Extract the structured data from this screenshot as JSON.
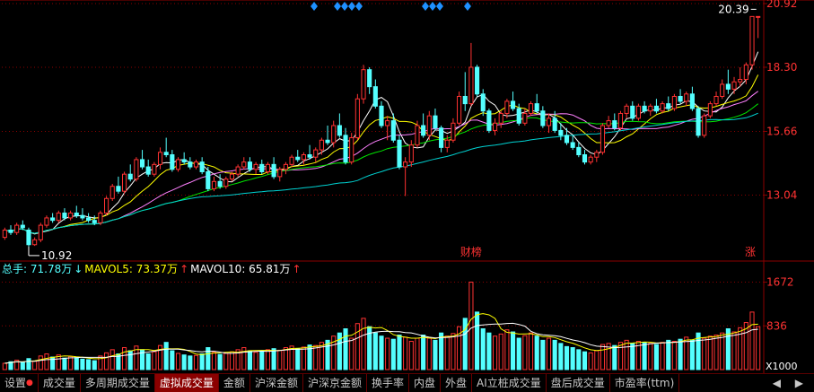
{
  "chart_data": [
    {
      "type": "candlestick",
      "price_axis_ticks": [
        "20.92",
        "18.30",
        "15.66",
        "13.04"
      ],
      "price_tick_values": [
        20.92,
        18.3,
        15.66,
        13.04
      ],
      "ylim": [
        10.4,
        20.92
      ],
      "last_price_label": "20.39",
      "last_price": 20.39,
      "low_label": "10.92",
      "low_price": 10.92,
      "low_bar_index": 4,
      "event_marker_label": "财榜",
      "event_marker_index": 78,
      "limit_up_label": "涨",
      "bars": [
        [
          11.3,
          11.7,
          11.2,
          11.6
        ],
        [
          11.6,
          11.8,
          11.4,
          11.5
        ],
        [
          11.5,
          11.9,
          11.4,
          11.8
        ],
        [
          11.8,
          12.0,
          11.6,
          11.7
        ],
        [
          11.6,
          11.7,
          10.92,
          11.0
        ],
        [
          11.0,
          11.3,
          10.95,
          11.2
        ],
        [
          11.2,
          11.9,
          11.1,
          11.8
        ],
        [
          11.8,
          12.2,
          11.7,
          12.1
        ],
        [
          12.1,
          12.3,
          11.9,
          12.0
        ],
        [
          12.0,
          12.4,
          11.9,
          12.3
        ],
        [
          12.3,
          12.5,
          12.0,
          12.1
        ],
        [
          12.1,
          12.4,
          12.0,
          12.3
        ],
        [
          12.3,
          12.6,
          12.1,
          12.2
        ],
        [
          12.2,
          12.5,
          12.0,
          12.1
        ],
        [
          12.1,
          12.3,
          11.9,
          12.0
        ],
        [
          12.0,
          12.2,
          11.8,
          11.9
        ],
        [
          11.9,
          12.4,
          11.8,
          12.3
        ],
        [
          12.3,
          13.0,
          12.2,
          12.9
        ],
        [
          12.9,
          13.5,
          12.8,
          13.4
        ],
        [
          13.4,
          13.8,
          13.1,
          13.2
        ],
        [
          13.2,
          14.0,
          13.1,
          13.9
        ],
        [
          13.9,
          14.3,
          13.6,
          13.7
        ],
        [
          13.7,
          14.6,
          13.6,
          14.5
        ],
        [
          14.5,
          14.9,
          14.1,
          14.2
        ],
        [
          14.2,
          14.5,
          13.8,
          13.9
        ],
        [
          13.9,
          14.4,
          13.8,
          14.3
        ],
        [
          14.3,
          15.0,
          14.1,
          14.8
        ],
        [
          14.8,
          15.4,
          14.6,
          14.7
        ],
        [
          14.7,
          14.9,
          14.0,
          14.1
        ],
        [
          14.1,
          14.6,
          14.0,
          14.5
        ],
        [
          14.5,
          14.8,
          14.3,
          14.4
        ],
        [
          14.4,
          14.6,
          14.1,
          14.2
        ],
        [
          14.2,
          14.5,
          14.1,
          14.4
        ],
        [
          14.4,
          14.6,
          13.9,
          14.0
        ],
        [
          14.0,
          14.2,
          13.2,
          13.3
        ],
        [
          13.3,
          13.8,
          13.2,
          13.6
        ],
        [
          13.6,
          13.9,
          13.3,
          13.4
        ],
        [
          13.4,
          13.8,
          13.3,
          13.7
        ],
        [
          13.7,
          14.0,
          13.6,
          13.9
        ],
        [
          13.9,
          14.3,
          13.8,
          14.2
        ],
        [
          14.2,
          14.6,
          14.1,
          14.4
        ],
        [
          14.4,
          14.6,
          14.0,
          14.1
        ],
        [
          14.1,
          14.4,
          13.9,
          14.3
        ],
        [
          14.3,
          14.5,
          13.9,
          14.0
        ],
        [
          14.0,
          14.4,
          13.9,
          14.3
        ],
        [
          14.3,
          14.6,
          13.7,
          13.8
        ],
        [
          13.8,
          14.2,
          13.6,
          14.1
        ],
        [
          14.1,
          14.4,
          13.9,
          14.3
        ],
        [
          14.3,
          14.7,
          14.2,
          14.6
        ],
        [
          14.6,
          14.9,
          14.4,
          14.5
        ],
        [
          14.5,
          14.8,
          14.3,
          14.7
        ],
        [
          14.7,
          15.1,
          14.5,
          14.6
        ],
        [
          14.6,
          15.0,
          14.4,
          14.9
        ],
        [
          14.9,
          15.4,
          14.7,
          15.3
        ],
        [
          15.3,
          15.9,
          15.1,
          15.2
        ],
        [
          15.2,
          16.1,
          15.0,
          15.9
        ],
        [
          15.9,
          16.4,
          15.4,
          15.5
        ],
        [
          15.5,
          15.8,
          14.3,
          14.4
        ],
        [
          14.4,
          15.6,
          14.3,
          15.4
        ],
        [
          15.4,
          17.2,
          15.3,
          17.0
        ],
        [
          17.0,
          18.4,
          16.8,
          18.2
        ],
        [
          18.2,
          18.3,
          17.2,
          17.5
        ],
        [
          17.5,
          17.8,
          16.6,
          16.7
        ],
        [
          16.7,
          16.9,
          15.8,
          15.9
        ],
        [
          15.9,
          16.3,
          15.3,
          16.1
        ],
        [
          16.1,
          16.4,
          15.2,
          15.3
        ],
        [
          15.3,
          15.5,
          14.1,
          14.2
        ],
        [
          14.2,
          14.6,
          13.0,
          14.4
        ],
        [
          14.4,
          15.3,
          14.2,
          15.1
        ],
        [
          15.1,
          16.1,
          15.0,
          15.9
        ],
        [
          15.9,
          16.4,
          15.4,
          15.5
        ],
        [
          15.5,
          16.5,
          15.3,
          16.3
        ],
        [
          16.3,
          16.6,
          15.7,
          15.8
        ],
        [
          15.8,
          15.9,
          14.8,
          15.0
        ],
        [
          15.0,
          15.5,
          14.8,
          15.3
        ],
        [
          15.3,
          16.2,
          15.2,
          16.0
        ],
        [
          16.0,
          17.3,
          15.9,
          17.1
        ],
        [
          17.1,
          18.1,
          16.5,
          16.8
        ],
        [
          16.8,
          19.3,
          16.7,
          18.3
        ],
        [
          18.3,
          18.4,
          17.1,
          17.2
        ],
        [
          17.2,
          17.4,
          16.3,
          16.5
        ],
        [
          16.5,
          16.6,
          15.6,
          15.7
        ],
        [
          15.7,
          16.2,
          15.5,
          16.0
        ],
        [
          16.0,
          16.5,
          15.8,
          16.4
        ],
        [
          16.4,
          17.0,
          16.2,
          16.9
        ],
        [
          16.9,
          17.3,
          16.5,
          16.6
        ],
        [
          16.6,
          16.8,
          15.9,
          16.0
        ],
        [
          16.0,
          16.6,
          15.9,
          16.4
        ],
        [
          16.4,
          16.9,
          16.3,
          16.8
        ],
        [
          16.8,
          17.2,
          16.4,
          16.5
        ],
        [
          16.5,
          16.7,
          15.8,
          15.9
        ],
        [
          15.9,
          16.4,
          15.6,
          16.2
        ],
        [
          16.2,
          16.5,
          15.6,
          15.7
        ],
        [
          15.7,
          16.0,
          15.3,
          15.5
        ],
        [
          15.5,
          15.8,
          15.1,
          15.2
        ],
        [
          15.2,
          15.5,
          14.9,
          15.0
        ],
        [
          15.0,
          15.2,
          14.6,
          14.7
        ],
        [
          14.7,
          14.9,
          14.3,
          14.4
        ],
        [
          14.4,
          14.7,
          14.3,
          14.6
        ],
        [
          14.6,
          14.9,
          14.4,
          14.8
        ],
        [
          14.8,
          16.0,
          14.7,
          15.9
        ],
        [
          15.9,
          16.3,
          15.8,
          16.1
        ],
        [
          16.1,
          16.4,
          15.7,
          15.8
        ],
        [
          15.8,
          16.5,
          15.7,
          16.4
        ],
        [
          16.4,
          16.8,
          16.2,
          16.7
        ],
        [
          16.7,
          16.9,
          16.1,
          16.2
        ],
        [
          16.2,
          16.8,
          16.1,
          16.7
        ],
        [
          16.7,
          16.9,
          16.4,
          16.5
        ],
        [
          16.5,
          16.8,
          16.3,
          16.7
        ],
        [
          16.7,
          17.0,
          16.4,
          16.5
        ],
        [
          16.5,
          16.9,
          16.4,
          16.8
        ],
        [
          16.8,
          17.1,
          16.5,
          16.6
        ],
        [
          16.6,
          17.2,
          16.5,
          17.1
        ],
        [
          17.1,
          17.4,
          16.8,
          16.9
        ],
        [
          16.9,
          17.3,
          16.7,
          17.2
        ],
        [
          17.2,
          17.5,
          16.5,
          16.6
        ],
        [
          16.6,
          16.7,
          15.4,
          15.5
        ],
        [
          15.5,
          16.4,
          15.4,
          16.3
        ],
        [
          16.3,
          16.9,
          16.2,
          16.8
        ],
        [
          16.8,
          17.3,
          16.7,
          17.1
        ],
        [
          17.1,
          17.8,
          17.0,
          17.6
        ],
        [
          17.6,
          18.2,
          17.2,
          17.4
        ],
        [
          17.4,
          17.9,
          17.2,
          17.7
        ],
        [
          17.7,
          18.3,
          17.5,
          17.8
        ],
        [
          17.8,
          18.5,
          17.6,
          18.4
        ],
        [
          18.4,
          19.0,
          18.2,
          20.39
        ],
        [
          20.39,
          20.4,
          19.5,
          20.39
        ]
      ],
      "volume_legend": {
        "total_label": "总手: 71.78万",
        "mavol5_label": "MAVOL5: 73.37万",
        "mavol10_label": "MAVOL10: 65.81万"
      },
      "volume_axis_ticks": [
        "1672",
        "836"
      ],
      "volume_tick_values": [
        1672,
        836
      ],
      "volume_unit_label": "X1000",
      "volumes": [
        120,
        150,
        180,
        140,
        210,
        160,
        260,
        300,
        240,
        280,
        220,
        250,
        230,
        200,
        190,
        170,
        260,
        320,
        380,
        300,
        420,
        360,
        450,
        380,
        300,
        340,
        460,
        520,
        360,
        310,
        280,
        260,
        270,
        300,
        420,
        330,
        290,
        310,
        340,
        380,
        420,
        360,
        330,
        350,
        380,
        400,
        370,
        420,
        450,
        400,
        430,
        470,
        460,
        520,
        560,
        640,
        700,
        780,
        600,
        880,
        980,
        820,
        700,
        640,
        600,
        580,
        660,
        620,
        540,
        600,
        660,
        600,
        560,
        700,
        640,
        690,
        820,
        980,
        1672,
        1100,
        780,
        700,
        640,
        680,
        760,
        720,
        600,
        650,
        700,
        640,
        560,
        600,
        560,
        500,
        440,
        420,
        380,
        340,
        320,
        360,
        480,
        500,
        460,
        520,
        560,
        500,
        540,
        520,
        500,
        480,
        520,
        560,
        540,
        580,
        620,
        560,
        700,
        600,
        640,
        660,
        700,
        780,
        720,
        800,
        900,
        1100,
        820
      ],
      "colors": {
        "up": "#ff3232",
        "down": "#54ffff",
        "ma5": "#ffffff",
        "ma10": "#ffff00",
        "ma20": "#ff80ff",
        "ma30": "#00e600",
        "ma60": "#00d2d2",
        "grid": "#8b0000",
        "axis_text": "#ff3232",
        "marker": "#1e90ff"
      }
    }
  ],
  "toolbar": {
    "tabs": [
      "设置",
      "成交量",
      "多周期成交量",
      "虚拟成交量",
      "金额",
      "沪深金额",
      "沪深京金额",
      "换手率",
      "内盘",
      "外盘",
      "AI立桩成交量",
      "盘后成交量",
      "市盈率(ttm)"
    ],
    "active_index": 3,
    "more_glyph": "◀ ▶"
  }
}
